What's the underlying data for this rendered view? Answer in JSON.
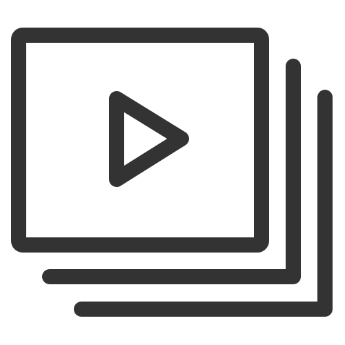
{
  "icon": {
    "name": "video-playlist-icon",
    "stroke_color": "#333333",
    "background": "#ffffff"
  }
}
